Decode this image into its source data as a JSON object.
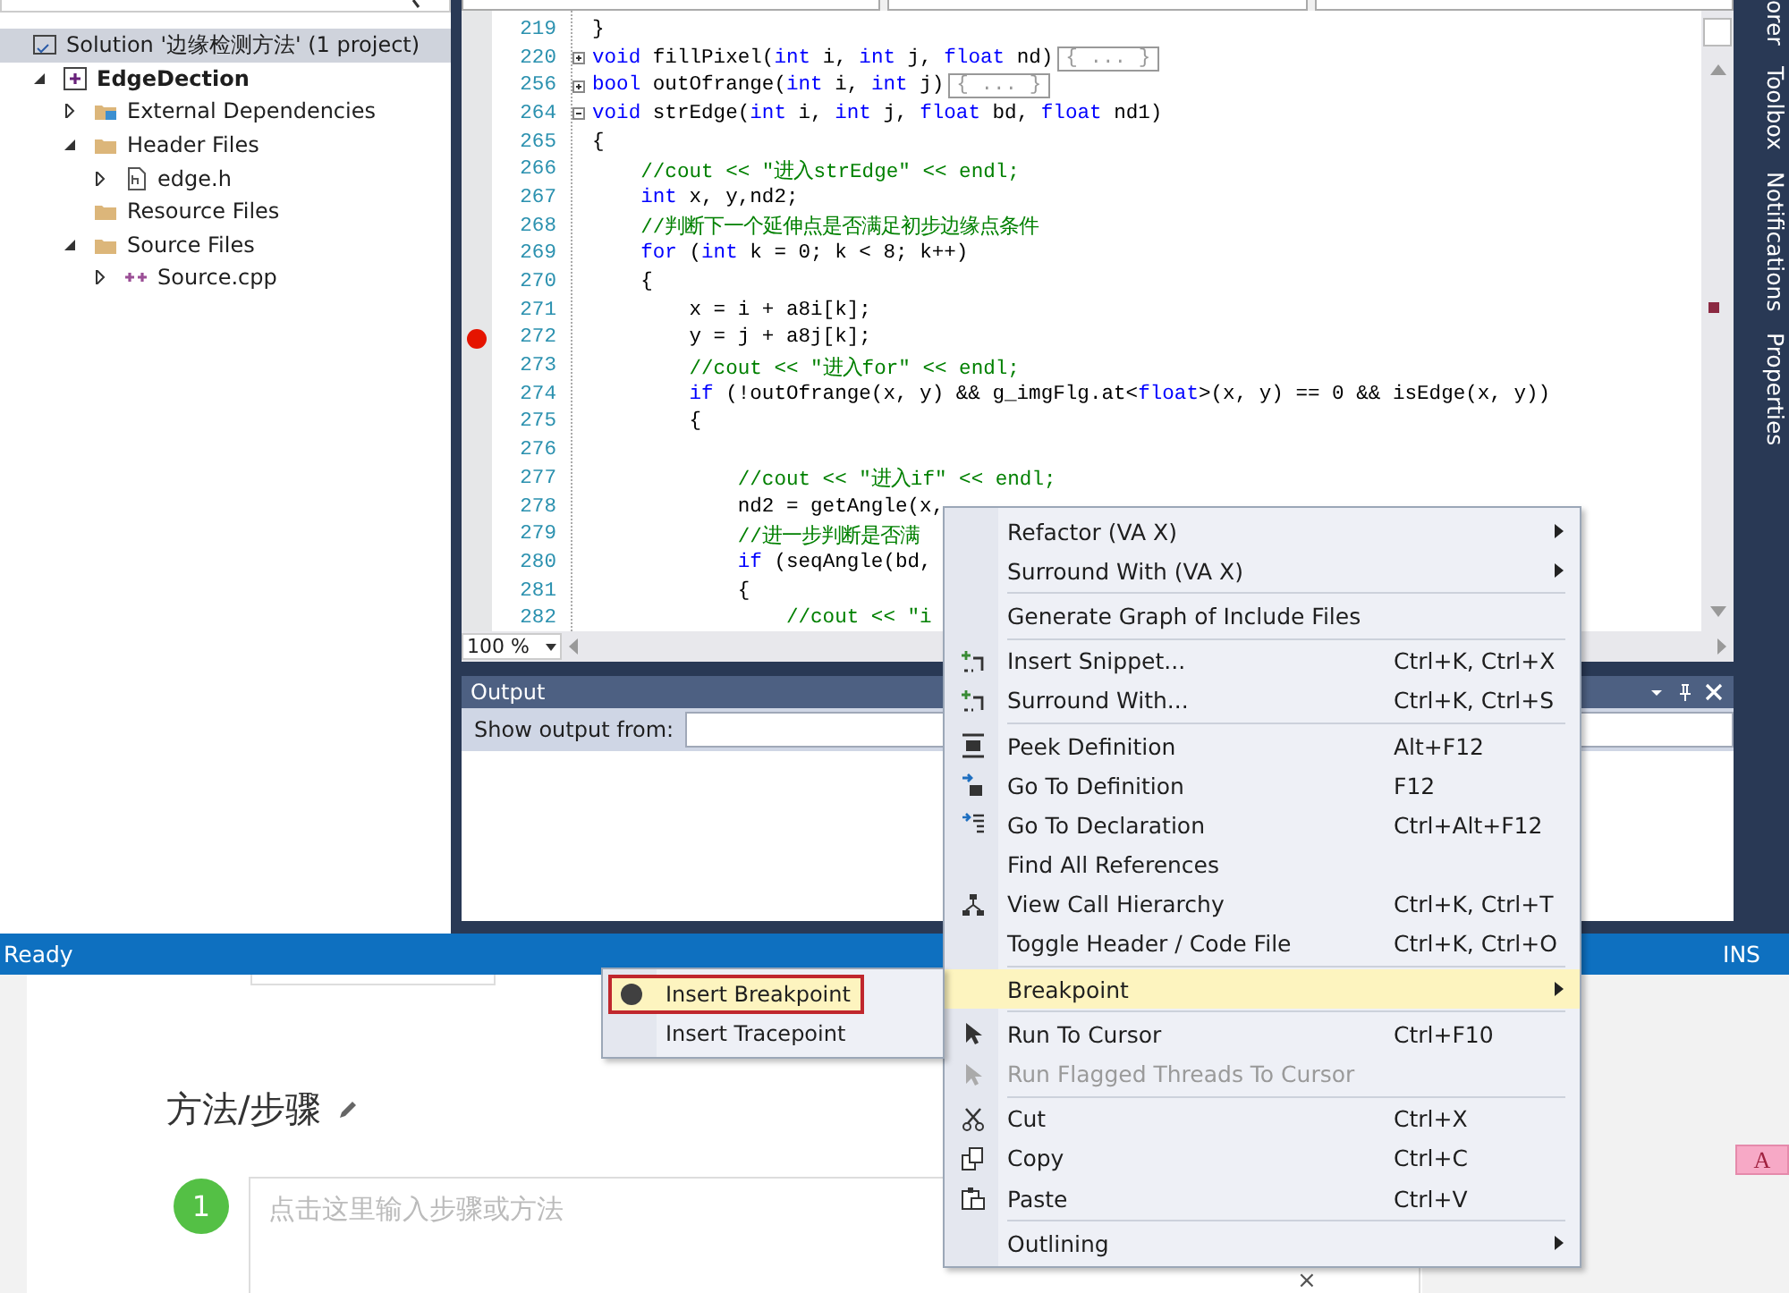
{
  "solution_explorer": {
    "tree": [
      {
        "label": "Solution '边缘检测方法' (1 project)",
        "kind": "solution",
        "selected": true,
        "children": [
          {
            "label": "EdgeDection",
            "kind": "project",
            "expanded": true,
            "selected": false,
            "children": [
              {
                "label": "External Dependencies",
                "kind": "references",
                "expanded": false,
                "selected": false
              },
              {
                "label": "Header Files",
                "kind": "folder",
                "expanded": true,
                "selected": false,
                "children": [
                  {
                    "label": "edge.h",
                    "kind": "header",
                    "expanded": false,
                    "selected": false
                  }
                ]
              },
              {
                "label": "Resource Files",
                "kind": "folder",
                "selected": false
              },
              {
                "label": "Source Files",
                "kind": "folder",
                "expanded": true,
                "selected": false,
                "children": [
                  {
                    "label": "Source.cpp",
                    "kind": "cpp",
                    "expanded": false,
                    "selected": false
                  }
                ]
              }
            ]
          }
        ]
      }
    ]
  },
  "editor": {
    "zoom": "100 %",
    "lines": [
      {
        "number": "219",
        "segments": [
          {
            "text": "}",
            "kind": "plain"
          }
        ]
      },
      {
        "number": "220",
        "collapsed": true,
        "hint": "{ ... }",
        "segments": [
          {
            "text": "void",
            "kind": "keyword"
          },
          {
            "text": " fillPixel(",
            "kind": "plain"
          },
          {
            "text": "int",
            "kind": "keyword"
          },
          {
            "text": " i, ",
            "kind": "plain"
          },
          {
            "text": "int",
            "kind": "keyword"
          },
          {
            "text": " j, ",
            "kind": "plain"
          },
          {
            "text": "float",
            "kind": "keyword"
          },
          {
            "text": " nd)",
            "kind": "plain"
          }
        ]
      },
      {
        "number": "256",
        "collapsed": true,
        "hint": "{ ... }",
        "segments": [
          {
            "text": "bool",
            "kind": "keyword"
          },
          {
            "text": " outOfrange(",
            "kind": "plain"
          },
          {
            "text": "int",
            "kind": "keyword"
          },
          {
            "text": " i, ",
            "kind": "plain"
          },
          {
            "text": "int",
            "kind": "keyword"
          },
          {
            "text": " j)",
            "kind": "plain"
          }
        ]
      },
      {
        "number": "264",
        "collapsed": false,
        "segments": [
          {
            "text": "void",
            "kind": "keyword"
          },
          {
            "text": " strEdge(",
            "kind": "plain"
          },
          {
            "text": "int",
            "kind": "keyword"
          },
          {
            "text": " i, ",
            "kind": "plain"
          },
          {
            "text": "int",
            "kind": "keyword"
          },
          {
            "text": " j, ",
            "kind": "plain"
          },
          {
            "text": "float",
            "kind": "keyword"
          },
          {
            "text": " bd, ",
            "kind": "plain"
          },
          {
            "text": "float",
            "kind": "keyword"
          },
          {
            "text": " nd1)",
            "kind": "plain"
          }
        ]
      },
      {
        "number": "265",
        "segments": [
          {
            "text": "{",
            "kind": "plain"
          }
        ]
      },
      {
        "number": "266",
        "segments": [
          {
            "text": "    //cout << \"进入strEdge\" << endl;",
            "kind": "comment"
          }
        ]
      },
      {
        "number": "267",
        "segments": [
          {
            "text": "    int",
            "kind": "keyword"
          },
          {
            "text": " x, y,nd2;",
            "kind": "plain"
          }
        ]
      },
      {
        "number": "268",
        "segments": [
          {
            "text": "    //判断下一个延伸点是否满足初步边缘点条件",
            "kind": "comment"
          }
        ]
      },
      {
        "number": "269",
        "segments": [
          {
            "text": "    for",
            "kind": "keyword"
          },
          {
            "text": " (",
            "kind": "plain"
          },
          {
            "text": "int",
            "kind": "keyword"
          },
          {
            "text": " k = 0; k < 8; k++)",
            "kind": "plain"
          }
        ]
      },
      {
        "number": "270",
        "segments": [
          {
            "text": "    {",
            "kind": "plain"
          }
        ]
      },
      {
        "number": "271",
        "segments": [
          {
            "text": "        x = i + a8i[k];",
            "kind": "plain"
          }
        ]
      },
      {
        "number": "272",
        "breakpoint": true,
        "segments": [
          {
            "text": "        y = j + a8j[k];",
            "kind": "plain"
          }
        ]
      },
      {
        "number": "273",
        "segments": [
          {
            "text": "        //cout << \"进入for\" << endl;",
            "kind": "comment"
          }
        ]
      },
      {
        "number": "274",
        "segments": [
          {
            "text": "        if",
            "kind": "keyword"
          },
          {
            "text": " (!outOfrange(x, y) && g_imgFlg.at<",
            "kind": "plain"
          },
          {
            "text": "float",
            "kind": "keyword"
          },
          {
            "text": ">(x, y) == 0 && isEdge(x, y))",
            "kind": "plain"
          }
        ]
      },
      {
        "number": "275",
        "segments": [
          {
            "text": "        {",
            "kind": "plain"
          }
        ]
      },
      {
        "number": "276"
      },
      {
        "number": "277",
        "segments": [
          {
            "text": "            //cout << \"进入if\" << endl;",
            "kind": "comment"
          }
        ]
      },
      {
        "number": "278",
        "segments": [
          {
            "text": "            nd2 = getAngle(x,",
            "kind": "plain"
          }
        ]
      },
      {
        "number": "279",
        "segments": [
          {
            "text": "            //进一步判断是否满",
            "kind": "comment"
          }
        ]
      },
      {
        "number": "280",
        "segments": [
          {
            "text": "            if",
            "kind": "keyword"
          },
          {
            "text": " (seqAngle(bd,",
            "kind": "plain"
          }
        ]
      },
      {
        "number": "281",
        "segments": [
          {
            "text": "            {",
            "kind": "plain"
          }
        ]
      },
      {
        "number": "282",
        "segments": [
          {
            "text": "                //cout << \"i",
            "kind": "comment"
          }
        ]
      }
    ]
  },
  "output": {
    "title": "Output",
    "source_label": "Show output from:"
  },
  "side_tabs": [
    "orer",
    "Toolbox",
    "Notifications",
    "Properties"
  ],
  "status_bar": {
    "message": "Ready",
    "mode": "INS"
  },
  "web_page": {
    "heading": "方法/步骤",
    "steps": [
      {
        "number": "1",
        "placeholder": "点击这里输入步骤或方法"
      }
    ],
    "close_mark": "×",
    "badge": "A"
  },
  "context_menu": {
    "items": [
      {
        "kind": "plain",
        "label": "Refactor (VA X)",
        "submenu": true,
        "selected": false
      },
      {
        "kind": "plain",
        "label": "Surround With (VA X)",
        "submenu": true,
        "selected": false
      },
      {
        "kind": "separator"
      },
      {
        "kind": "plain",
        "label": "Generate Graph of Include Files",
        "selected": false
      },
      {
        "kind": "separator"
      },
      {
        "kind": "snippet",
        "label": "Insert Snippet...",
        "shortcut": "Ctrl+K, Ctrl+X",
        "selected": false
      },
      {
        "kind": "snippet",
        "label": "Surround With...",
        "shortcut": "Ctrl+K, Ctrl+S",
        "selected": false
      },
      {
        "kind": "separator"
      },
      {
        "kind": "peek",
        "label": "Peek Definition",
        "shortcut": "Alt+F12",
        "selected": false
      },
      {
        "kind": "goto",
        "label": "Go To Definition",
        "shortcut": "F12",
        "selected": false
      },
      {
        "kind": "declaration",
        "label": "Go To Declaration",
        "shortcut": "Ctrl+Alt+F12",
        "selected": false
      },
      {
        "kind": "plain",
        "label": "Find All References",
        "selected": false
      },
      {
        "kind": "hierarchy",
        "label": "View Call Hierarchy",
        "shortcut": "Ctrl+K, Ctrl+T",
        "selected": false
      },
      {
        "kind": "plain",
        "label": "Toggle Header / Code File",
        "shortcut": "Ctrl+K, Ctrl+O",
        "selected": false
      },
      {
        "kind": "separator"
      },
      {
        "kind": "plain",
        "label": "Breakpoint",
        "submenu": true,
        "selected": true
      },
      {
        "kind": "separator"
      },
      {
        "kind": "cursor",
        "label": "Run To Cursor",
        "shortcut": "Ctrl+F10",
        "selected": false
      },
      {
        "kind": "cursor",
        "label": "Run Flagged Threads To Cursor",
        "disabled": true,
        "selected": false
      },
      {
        "kind": "separator"
      },
      {
        "kind": "cut",
        "label": "Cut",
        "shortcut": "Ctrl+X",
        "selected": false
      },
      {
        "kind": "copy",
        "label": "Copy",
        "shortcut": "Ctrl+C",
        "selected": false
      },
      {
        "kind": "paste",
        "label": "Paste",
        "shortcut": "Ctrl+V",
        "selected": false
      },
      {
        "kind": "separator"
      },
      {
        "kind": "plain",
        "label": "Outlining",
        "submenu": true,
        "selected": false
      }
    ]
  },
  "breakpoint_submenu": {
    "items": [
      {
        "kind": "dot",
        "label": "Insert Breakpoint",
        "selected": true
      },
      {
        "kind": "plain",
        "label": "Insert Tracepoint",
        "selected": false
      }
    ]
  }
}
